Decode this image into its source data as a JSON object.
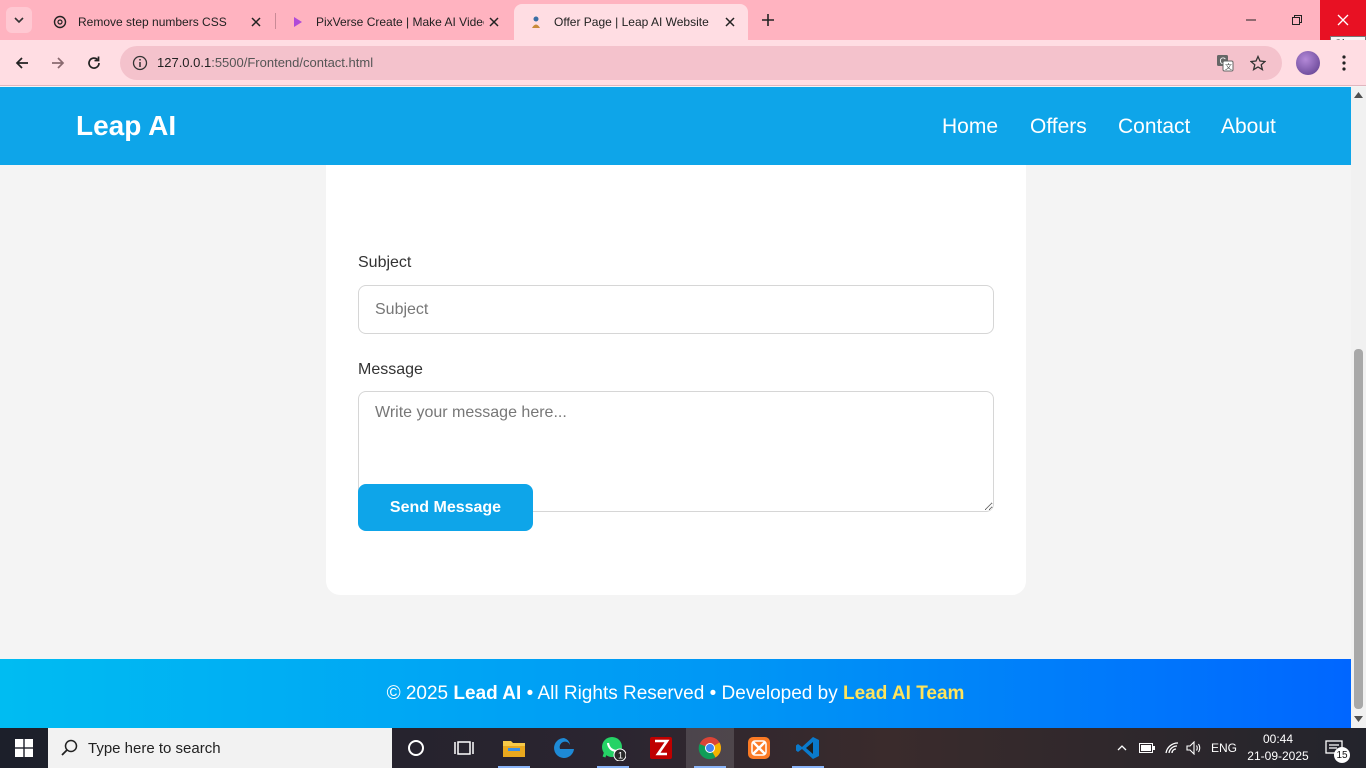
{
  "browser": {
    "tabs": [
      {
        "title": "Remove step numbers CSS",
        "icon": "chatgpt-icon"
      },
      {
        "title": "PixVerse Create | Make AI Video",
        "icon": "pixverse-icon"
      },
      {
        "title": "Offer Page | Leap AI Website",
        "icon": "site-icon",
        "active": true
      }
    ],
    "address": {
      "host": "127.0.0.1",
      "path": ":5500/Frontend/contact.html"
    },
    "close_tooltip": "Close",
    "accent_color": "#ffb3c0"
  },
  "site": {
    "brand": "Leap AI",
    "nav": [
      "Home",
      "Offers",
      "Contact",
      "About"
    ],
    "header_color": "#0ea5e9"
  },
  "form": {
    "subject_label": "Subject",
    "subject_placeholder": "Subject",
    "message_label": "Message",
    "message_placeholder": "Write your message here...",
    "submit_label": "Send Message"
  },
  "footer": {
    "prefix": "© 2025 ",
    "brand": "Lead AI",
    "middle": " • All Rights Reserved • Developed by ",
    "team": "Lead AI Team",
    "team_color": "#ffe45c"
  },
  "taskbar": {
    "search_placeholder": "Type here to search",
    "apps": [
      "cortana-icon",
      "task-view-icon",
      "file-explorer-icon",
      "edge-icon",
      "whatsapp-icon",
      "filezilla-icon",
      "chrome-icon",
      "xampp-icon",
      "vscode-icon"
    ],
    "whatsapp_badge": "1",
    "language": "ENG",
    "time": "00:44",
    "date": "21-09-2025",
    "notification_count": "15"
  }
}
